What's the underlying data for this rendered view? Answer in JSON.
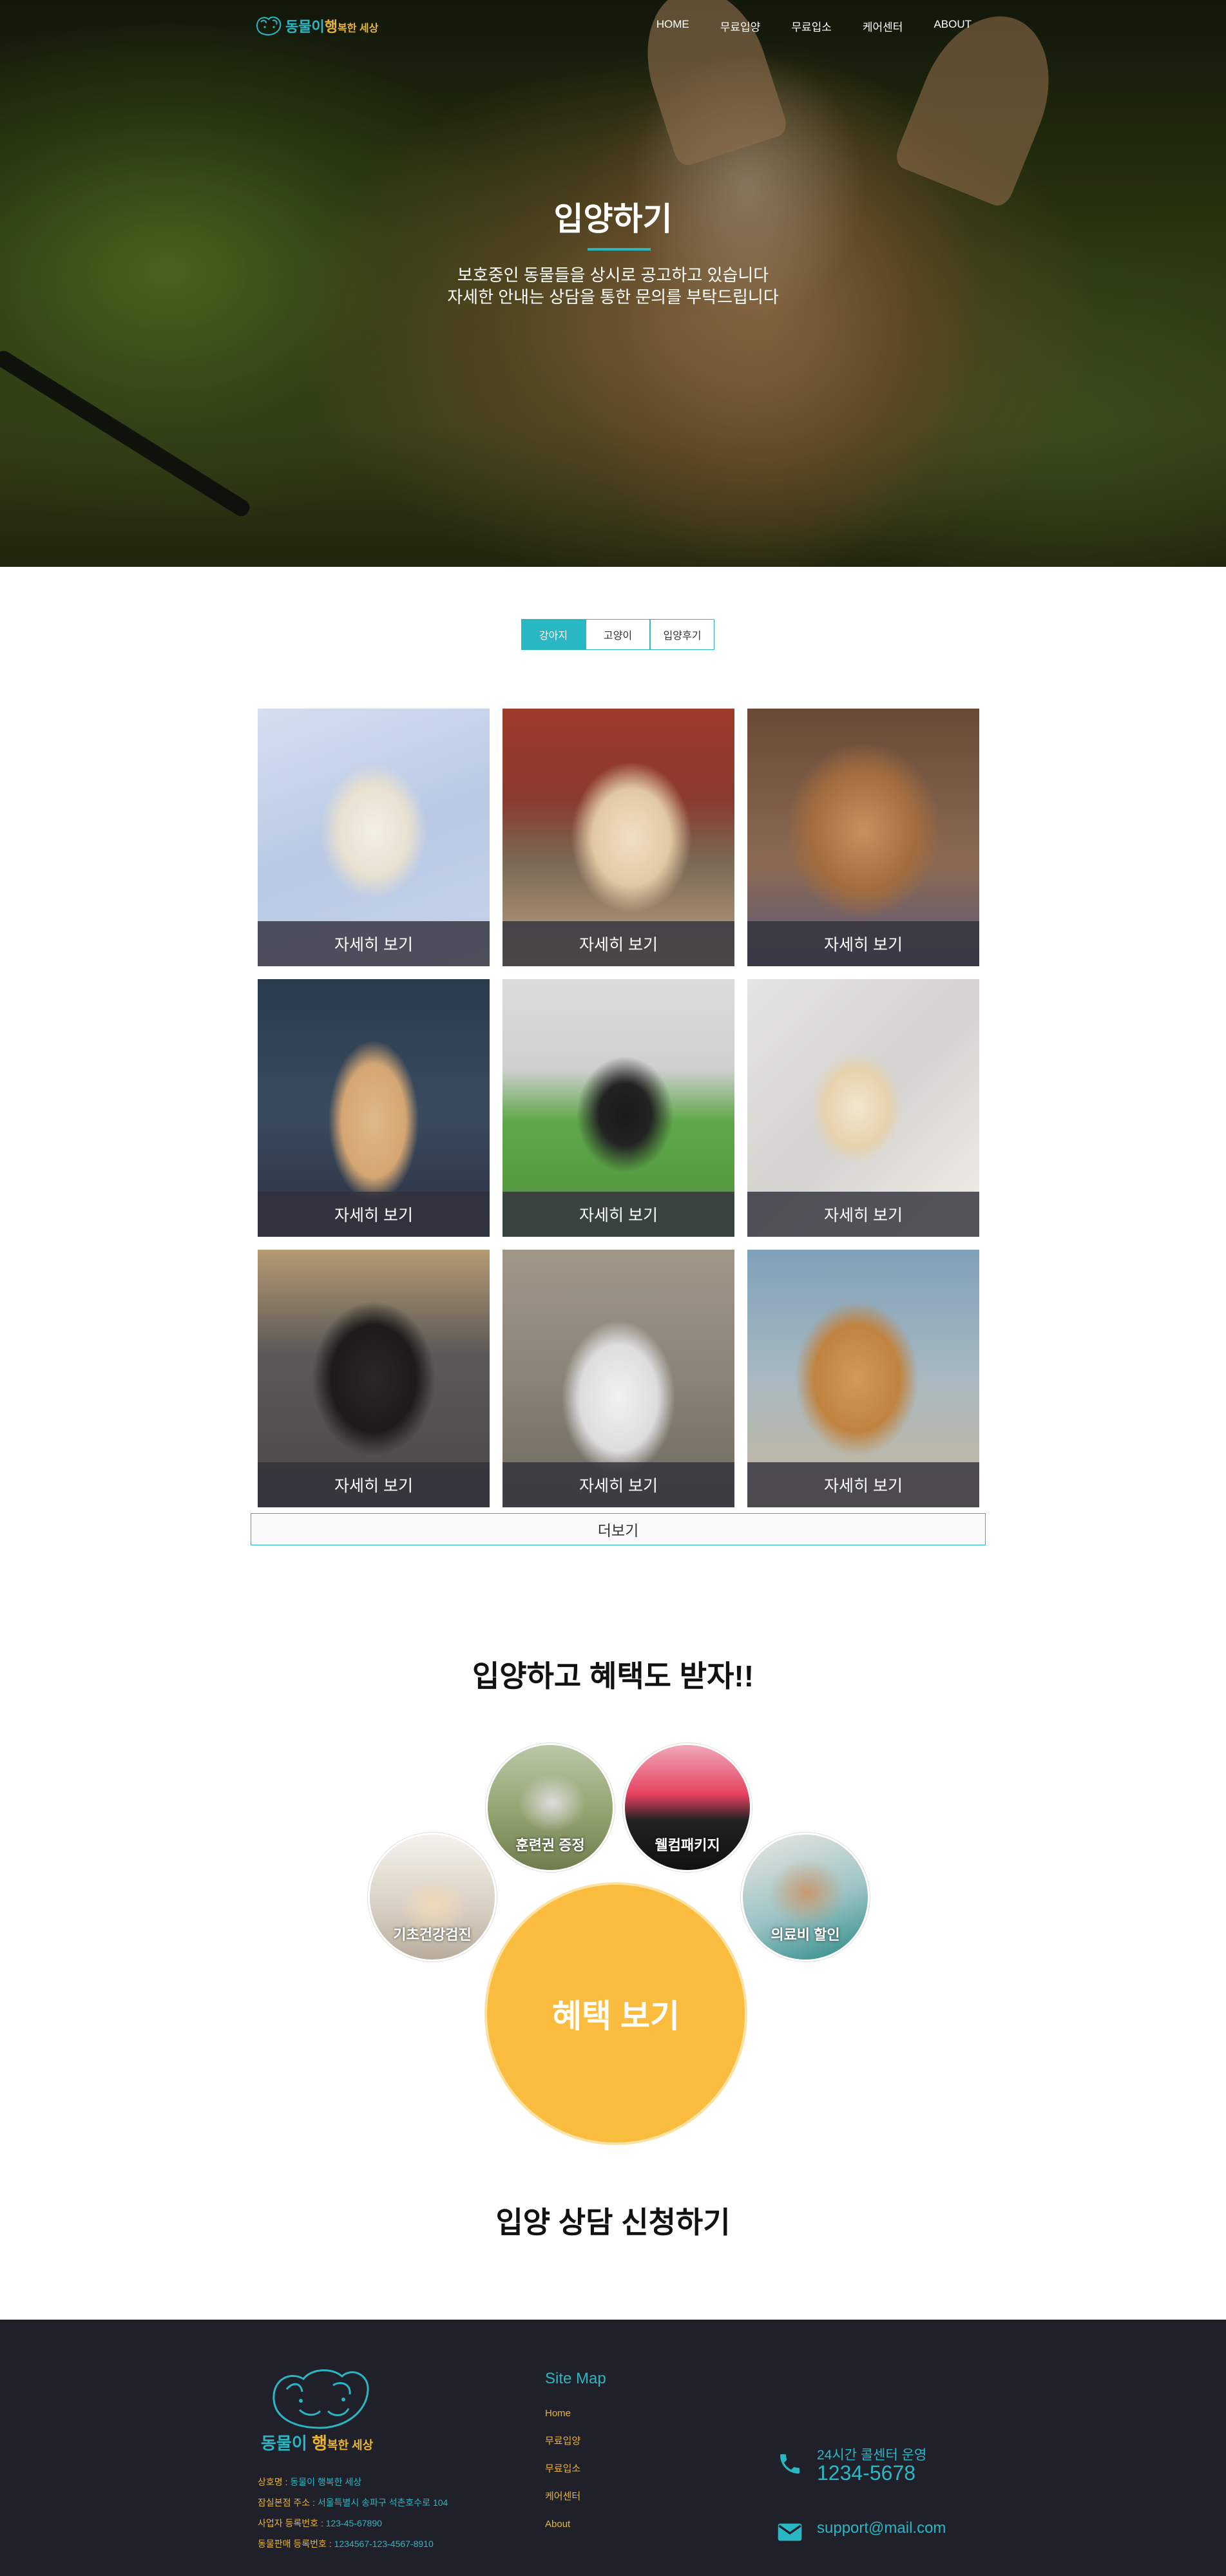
{
  "brand": {
    "logo_text_1": "동물이",
    "logo_text_2": "행",
    "logo_text_3": "복한 세상"
  },
  "nav": {
    "items": [
      {
        "label": "HOME"
      },
      {
        "label": "무료입양"
      },
      {
        "label": "무료입소"
      },
      {
        "label": "케어센터"
      },
      {
        "label": "ABOUT"
      }
    ]
  },
  "hero": {
    "title": "입양하기",
    "subtitle_line1": "보호중인 동물들을 상시로 공고하고 있습니다",
    "subtitle_line2": "자세한 안내는 상담을 통한 문의를 부탁드립니다"
  },
  "tabs": [
    {
      "label": "강아지",
      "active": true
    },
    {
      "label": "고양이",
      "active": false
    },
    {
      "label": "입양후기",
      "active": false
    }
  ],
  "pets": [
    {
      "caption": "자세히 보기"
    },
    {
      "caption": "자세히 보기"
    },
    {
      "caption": "자세히 보기"
    },
    {
      "caption": "자세히 보기"
    },
    {
      "caption": "자세히 보기"
    },
    {
      "caption": "자세히 보기"
    },
    {
      "caption": "자세히 보기"
    },
    {
      "caption": "자세히 보기"
    },
    {
      "caption": "자세히 보기"
    }
  ],
  "more_label": "더보기",
  "benefits": {
    "title": "입양하고 혜택도 받자!!",
    "items": [
      {
        "label": "훈련권 증정"
      },
      {
        "label": "웰컴패키지"
      },
      {
        "label": "기초건강검진"
      },
      {
        "label": "의료비 할인"
      }
    ],
    "main_label": "혜택 보기"
  },
  "consult": {
    "title": "입양 상담 신청하기"
  },
  "footer": {
    "brand_1": "동물이",
    "brand_2": "행",
    "brand_3": "복한 세상",
    "info": [
      {
        "label": "상호명 : ",
        "value": "동물이 행복한 세상"
      },
      {
        "label": "잠실본점 주소 : ",
        "value": "서울특별시 송파구 석촌호수로 104"
      },
      {
        "label": "사업자 등록번호 : ",
        "value": "123-45-67890"
      },
      {
        "label": "동물판매 등록번호 : ",
        "value": "1234567-123-4567-8910"
      }
    ],
    "sitemap_title": "Site Map",
    "sitemap": [
      {
        "label": "Home"
      },
      {
        "label": "무료입양"
      },
      {
        "label": "무료입소"
      },
      {
        "label": "케어센터"
      },
      {
        "label": "About"
      }
    ],
    "hours": "24시간 콜센터 운영",
    "phone": "1234-5678",
    "email": "support@mail.com"
  },
  "colors": {
    "accent": "#2ab7c4",
    "brand_yellow": "#e8b437",
    "benefit_circle": "#f9bc3e",
    "footer_bg": "#20202a"
  },
  "icons": {
    "logo": "dog-cat-logo-icon",
    "phone": "phone-icon",
    "mail": "mail-icon"
  }
}
